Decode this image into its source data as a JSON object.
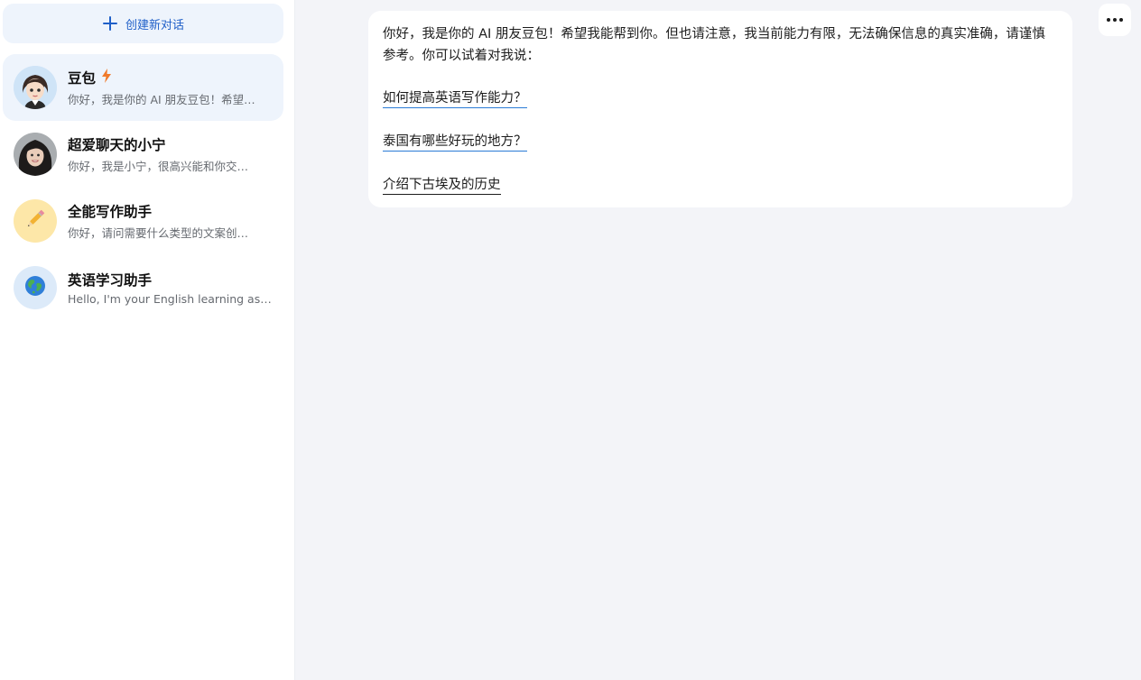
{
  "sidebar": {
    "new_chat_label": "创建新对话",
    "conversations": [
      {
        "title": "豆包",
        "preview": "你好，我是你的 AI 朋友豆包！希望…",
        "badge_icon": "lightning-icon",
        "active": true
      },
      {
        "title": "超爱聊天的小宁",
        "preview": "你好，我是小宁，很高兴能和你交…",
        "active": false
      },
      {
        "title": "全能写作助手",
        "preview": "你好，请问需要什么类型的文案创…",
        "avatar_icon": "pencil-icon",
        "active": false
      },
      {
        "title": "英语学习助手",
        "preview": "Hello, I'm your English learning ass…",
        "avatar_icon": "globe-icon",
        "active": false
      }
    ]
  },
  "main": {
    "message": {
      "intro": "你好，我是你的 AI 朋友豆包！希望我能帮到你。但也请注意，我当前能力有限，无法确保信息的真实准确，请谨慎参考。你可以试着对我说：",
      "suggestions": [
        "如何提高英语写作能力？",
        "泰国有哪些好玩的地方？",
        "介绍下古埃及的历史"
      ]
    }
  },
  "colors": {
    "accent": "#1f5fc8",
    "active_bg": "#eef4fc",
    "main_bg": "#f3f4f8",
    "lightning": "#f07a2a"
  }
}
